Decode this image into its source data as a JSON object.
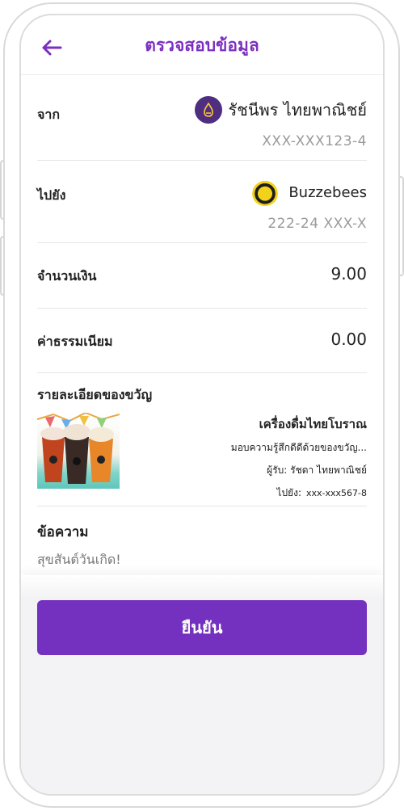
{
  "header": {
    "title": "ตรวจสอบข้อมูล",
    "back_icon": "arrow-left-icon"
  },
  "from": {
    "label": "จาก",
    "name": "รัชนีพร ไทยพาณิชย์",
    "account": "XXX-XXX123-4",
    "bank_icon": "scb-bank-logo-icon"
  },
  "to": {
    "label": "ไปยัง",
    "name": "Buzzebees",
    "account": "222-24 XXX-X",
    "merchant_icon": "buzzebees-logo-icon"
  },
  "amount": {
    "label": "จำนวนเงิน",
    "value": "9.00"
  },
  "fee": {
    "label": "ค่าธรรมเนียม",
    "value": "0.00"
  },
  "gift": {
    "label": "รายละเอียดของขวัญ",
    "name": "เครื่องดื่มไทยโบราณ",
    "description": "มอบความรู้สึกดีดีด้วยของขวัญ...",
    "recipient": "ผู้รับ: รัชดา ไทยพาณิชย์",
    "destination_label": "ไปยัง:",
    "destination_account": "xxx-xxx567-8"
  },
  "message": {
    "label": "ข้อความ",
    "text": "สุขสันต์วันเกิด!"
  },
  "actions": {
    "confirm_label": "ยืนยัน"
  },
  "colors": {
    "accent": "#7431bf",
    "title": "#7b2fbf",
    "bank": "#4f2d7f"
  }
}
